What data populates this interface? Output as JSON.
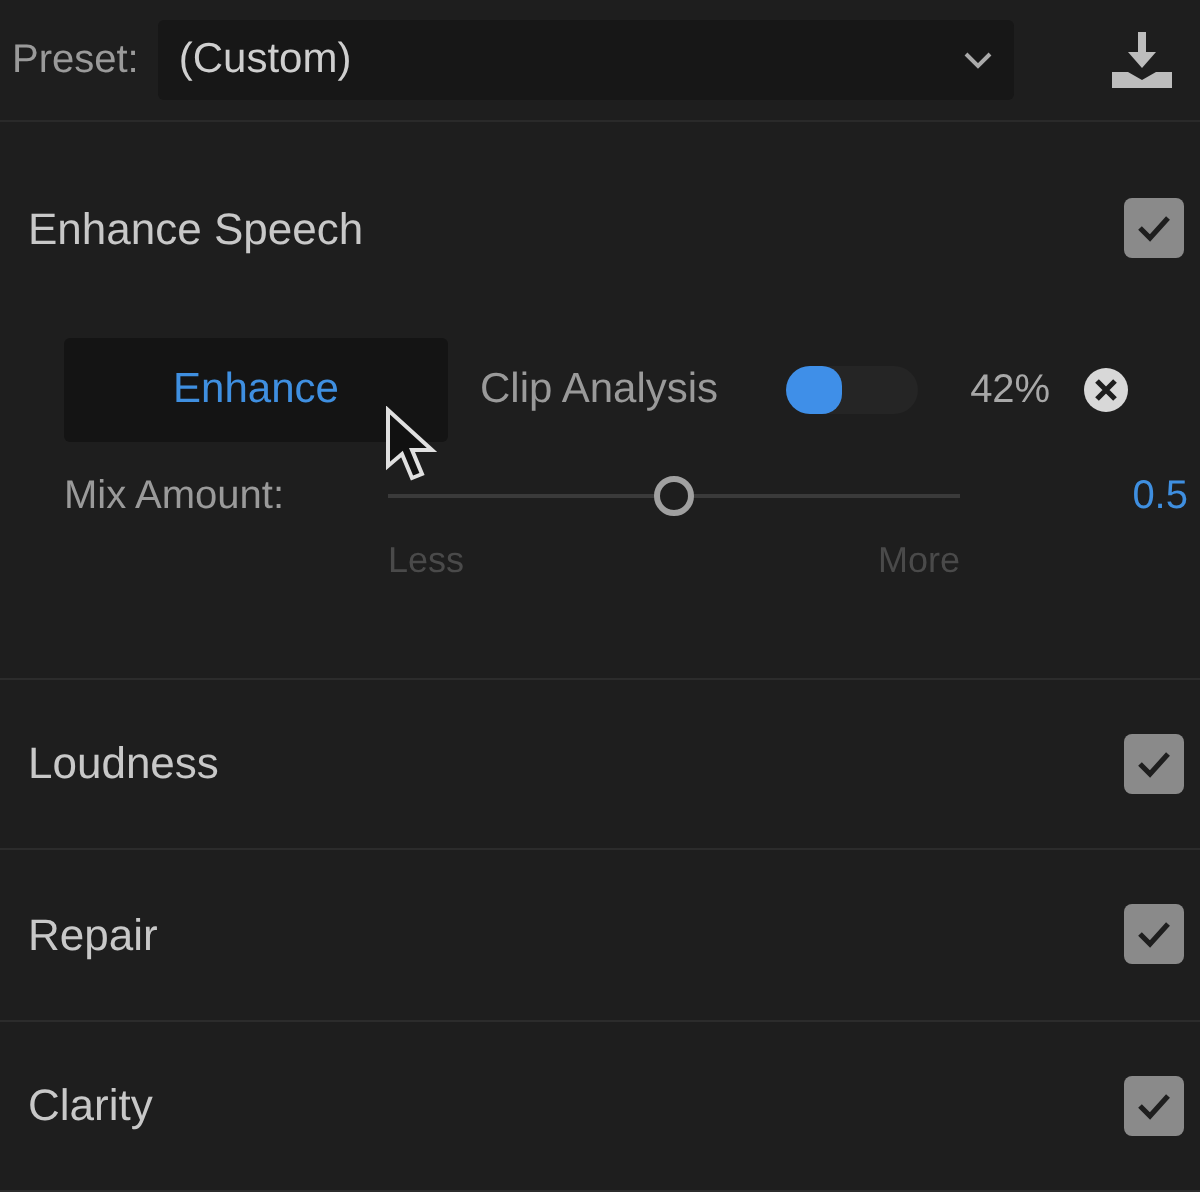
{
  "preset": {
    "label": "Preset:",
    "value": "(Custom)"
  },
  "enhance_speech": {
    "title": "Enhance Speech",
    "checked": true,
    "button": "Enhance",
    "analysis_label": "Clip Analysis",
    "analysis": {
      "level": 0.42
    },
    "analysis_reading": "42%",
    "mix": {
      "label": "Mix Amount:",
      "level": 0.5,
      "min_label": "Less",
      "max_label": "More",
      "reading": "0.5"
    }
  },
  "sections": [
    {
      "title": "Loudness",
      "checked": true
    },
    {
      "title": "Repair",
      "checked": true
    },
    {
      "title": "Clarity",
      "checked": true
    }
  ]
}
